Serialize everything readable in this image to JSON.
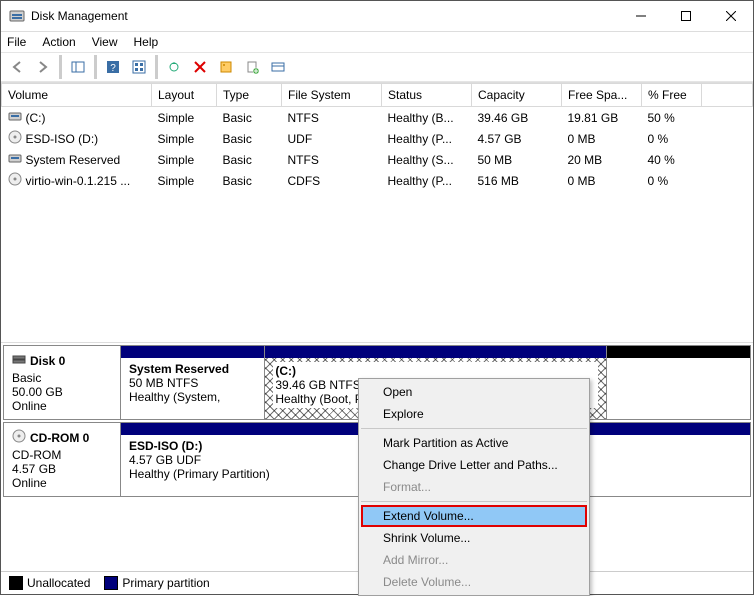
{
  "title": "Disk Management",
  "menu": {
    "file": "File",
    "action": "Action",
    "view": "View",
    "help": "Help"
  },
  "columns": {
    "volume": "Volume",
    "layout": "Layout",
    "type": "Type",
    "fs": "File System",
    "status": "Status",
    "capacity": "Capacity",
    "free": "Free Spa...",
    "pfree": "% Free"
  },
  "volumes": [
    {
      "name": "(C:)",
      "layout": "Simple",
      "type": "Basic",
      "fs": "NTFS",
      "status": "Healthy (B...",
      "capacity": "39.46 GB",
      "free": "19.81 GB",
      "pfree": "50 %",
      "icon": "drive-icon"
    },
    {
      "name": "ESD-ISO (D:)",
      "layout": "Simple",
      "type": "Basic",
      "fs": "UDF",
      "status": "Healthy (P...",
      "capacity": "4.57 GB",
      "free": "0 MB",
      "pfree": "0 %",
      "icon": "cd-icon"
    },
    {
      "name": "System Reserved",
      "layout": "Simple",
      "type": "Basic",
      "fs": "NTFS",
      "status": "Healthy (S...",
      "capacity": "50 MB",
      "free": "20 MB",
      "pfree": "40 %",
      "icon": "drive-icon"
    },
    {
      "name": "virtio-win-0.1.215 ...",
      "layout": "Simple",
      "type": "Basic",
      "fs": "CDFS",
      "status": "Healthy (P...",
      "capacity": "516 MB",
      "free": "0 MB",
      "pfree": "0 %",
      "icon": "cd-icon"
    }
  ],
  "disks": [
    {
      "name": "Disk 0",
      "kind": "Basic",
      "size": "50.00 GB",
      "state": "Online",
      "icon": "hdd-icon",
      "parts": [
        {
          "name": "System Reserved",
          "line2": "50 MB NTFS",
          "line3": "Healthy (System,",
          "flex": 0.22,
          "hatched": false
        },
        {
          "name": "(C:)",
          "line2": "39.46 GB NTFS",
          "line3": "Healthy (Boot, Page F",
          "flex": 0.56,
          "hatched": true
        },
        {
          "name": "",
          "line2": "",
          "line3": "",
          "flex": 0.22,
          "unallocated": true
        }
      ]
    },
    {
      "name": "CD-ROM 0",
      "kind": "CD-ROM",
      "size": "4.57 GB",
      "state": "Online",
      "icon": "cd-icon",
      "parts": [
        {
          "name": "ESD-ISO  (D:)",
          "line2": "4.57 GB UDF",
          "line3": "Healthy (Primary Partition)",
          "flex": 1,
          "hatched": false
        }
      ]
    }
  ],
  "legend": {
    "unalloc": "Unallocated",
    "primary": "Primary partition"
  },
  "ctx": {
    "open": "Open",
    "explore": "Explore",
    "mark": "Mark Partition as Active",
    "letter": "Change Drive Letter and Paths...",
    "format": "Format...",
    "extend": "Extend Volume...",
    "shrink": "Shrink Volume...",
    "mirror": "Add Mirror...",
    "delete": "Delete Volume..."
  }
}
